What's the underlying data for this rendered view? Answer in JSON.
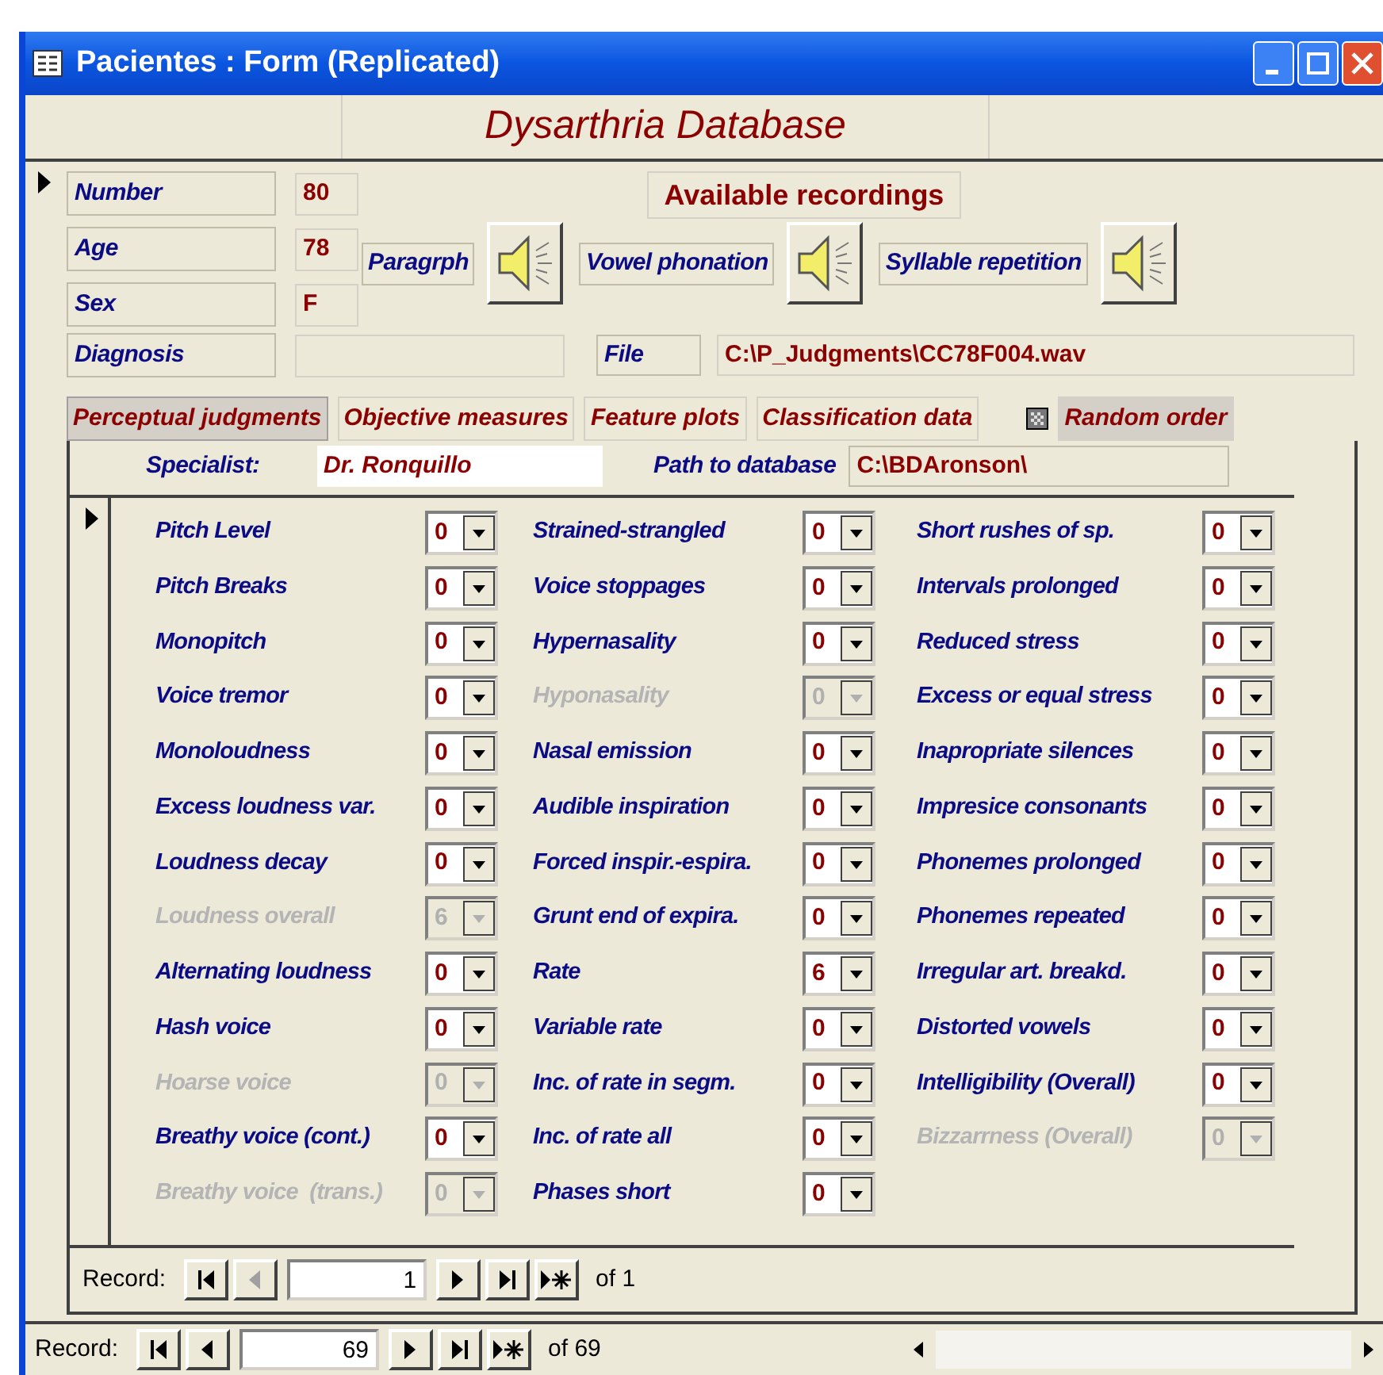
{
  "window": {
    "title": "Pacientes : Form (Replicated)"
  },
  "header": {
    "title": "Dysarthria Database"
  },
  "patient": [
    {
      "label": "Number",
      "value": "80"
    },
    {
      "label": "Age",
      "value": "78"
    },
    {
      "label": "Sex",
      "value": "F"
    },
    {
      "label": "Diagnosis"
    }
  ],
  "recordings": {
    "title": "Available recordings",
    "items": [
      {
        "label": "Paragrph"
      },
      {
        "label": "Vowel phonation"
      },
      {
        "label": "Syllable repetition"
      }
    ]
  },
  "file": {
    "label": "File",
    "value": "C:\\P_Judgments\\CC78F004.wav"
  },
  "tabs": [
    {
      "label": "Perceptual judgments",
      "selected": true
    },
    {
      "label": "Objective measures",
      "selected": false
    },
    {
      "label": "Feature plots",
      "selected": false
    },
    {
      "label": "Classification data",
      "selected": false
    }
  ],
  "random_order": {
    "label": "Random order"
  },
  "specialist": {
    "label": "Specialist:",
    "value": "Dr. Ronquillo"
  },
  "path": {
    "label": "Path to database",
    "value": "C:\\BDAronson\\"
  },
  "ratings": [
    [
      {
        "label": "Pitch Level",
        "value": "0",
        "disabled": false
      },
      {
        "label": "Pitch Breaks",
        "value": "0",
        "disabled": false
      },
      {
        "label": "Monopitch",
        "value": "0",
        "disabled": false
      },
      {
        "label": "Voice tremor",
        "value": "0",
        "disabled": false
      },
      {
        "label": "Monoloudness",
        "value": "0",
        "disabled": false
      },
      {
        "label": "Excess loudness var.",
        "value": "0",
        "disabled": false
      },
      {
        "label": "Loudness decay",
        "value": "0",
        "disabled": false
      },
      {
        "label": "Loudness overall",
        "value": "6",
        "disabled": true
      },
      {
        "label": "Alternating loudness",
        "value": "0",
        "disabled": false
      },
      {
        "label": "Hash voice",
        "value": "0",
        "disabled": false
      },
      {
        "label": "Hoarse voice",
        "value": "0",
        "disabled": true
      },
      {
        "label": "Breathy voice (cont.)",
        "value": "0",
        "disabled": false
      },
      {
        "label": "Breathy voice  (trans.)",
        "value": "0",
        "disabled": true
      }
    ],
    [
      {
        "label": "Strained-strangled",
        "value": "0",
        "disabled": false
      },
      {
        "label": "Voice stoppages",
        "value": "0",
        "disabled": false
      },
      {
        "label": "Hypernasality",
        "value": "0",
        "disabled": false
      },
      {
        "label": "Hyponasality",
        "value": "0",
        "disabled": true
      },
      {
        "label": "Nasal emission",
        "value": "0",
        "disabled": false
      },
      {
        "label": "Audible inspiration",
        "value": "0",
        "disabled": false
      },
      {
        "label": "Forced inspir.-espira.",
        "value": "0",
        "disabled": false
      },
      {
        "label": "Grunt end of expira.",
        "value": "0",
        "disabled": false
      },
      {
        "label": "Rate",
        "value": "6",
        "disabled": false
      },
      {
        "label": "Variable rate",
        "value": "0",
        "disabled": false
      },
      {
        "label": "Inc. of rate in segm.",
        "value": "0",
        "disabled": false
      },
      {
        "label": "Inc. of rate all",
        "value": "0",
        "disabled": false
      },
      {
        "label": "Phases short",
        "value": "0",
        "disabled": false
      }
    ],
    [
      {
        "label": "Short rushes of sp.",
        "value": "0",
        "disabled": false
      },
      {
        "label": "Intervals prolonged",
        "value": "0",
        "disabled": false
      },
      {
        "label": "Reduced stress",
        "value": "0",
        "disabled": false
      },
      {
        "label": "Excess or equal stress",
        "value": "0",
        "disabled": false
      },
      {
        "label": "Inapropriate silences",
        "value": "0",
        "disabled": false
      },
      {
        "label": "Impresice consonants",
        "value": "0",
        "disabled": false
      },
      {
        "label": "Phonemes prolonged",
        "value": "0",
        "disabled": false
      },
      {
        "label": "Phonemes repeated",
        "value": "0",
        "disabled": false
      },
      {
        "label": "Irregular art. breakd.",
        "value": "0",
        "disabled": false
      },
      {
        "label": "Distorted vowels",
        "value": "0",
        "disabled": false
      },
      {
        "label": "Intelligibility (Overall)",
        "value": "0",
        "disabled": false
      },
      {
        "label": "Bizzarrness (Overall)",
        "value": "0",
        "disabled": true
      }
    ]
  ],
  "subform_navigator": {
    "label": "Record:",
    "value": "1",
    "total": "of 1",
    "buttons": [
      {
        "kind": "first",
        "disabled": false
      },
      {
        "kind": "prev",
        "disabled": true
      },
      {
        "kind": "next",
        "disabled": false
      },
      {
        "kind": "last",
        "disabled": false
      },
      {
        "kind": "new",
        "disabled": false
      }
    ]
  },
  "form_navigator": {
    "label": "Record:",
    "value": "69",
    "total": "of 69",
    "buttons": [
      {
        "kind": "first",
        "disabled": false
      },
      {
        "kind": "prev",
        "disabled": false
      },
      {
        "kind": "next",
        "disabled": false
      },
      {
        "kind": "last",
        "disabled": false
      },
      {
        "kind": "new",
        "disabled": false
      }
    ]
  }
}
